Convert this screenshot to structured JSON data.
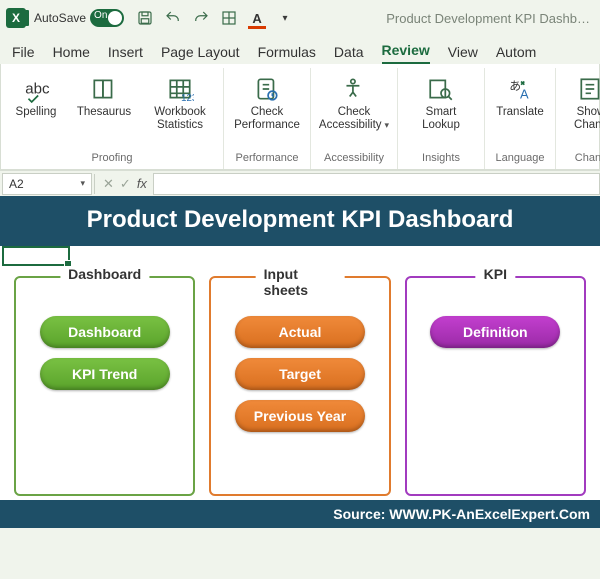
{
  "titlebar": {
    "autosave_label": "AutoSave",
    "autosave_state": "On",
    "doc_title": "Product Development KPI Dashb…"
  },
  "tabs": {
    "items": [
      "File",
      "Home",
      "Insert",
      "Page Layout",
      "Formulas",
      "Data",
      "Review",
      "View",
      "Autom"
    ],
    "active": "Review"
  },
  "ribbon": {
    "groups": [
      {
        "label": "Proofing",
        "items": [
          {
            "name": "spelling",
            "label": "Spelling"
          },
          {
            "name": "thesaurus",
            "label": "Thesaurus"
          },
          {
            "name": "workbook-stats",
            "label": "Workbook Statistics"
          }
        ]
      },
      {
        "label": "Performance",
        "items": [
          {
            "name": "check-performance",
            "label": "Check Performance"
          }
        ]
      },
      {
        "label": "Accessibility",
        "items": [
          {
            "name": "check-accessibility",
            "label": "Check Accessibility",
            "dropdown": true
          }
        ]
      },
      {
        "label": "Insights",
        "items": [
          {
            "name": "smart-lookup",
            "label": "Smart Lookup"
          }
        ]
      },
      {
        "label": "Language",
        "items": [
          {
            "name": "translate",
            "label": "Translate"
          }
        ]
      },
      {
        "label": "Chang",
        "items": [
          {
            "name": "show-changes",
            "label": "Show Chang"
          }
        ]
      }
    ]
  },
  "namebox": {
    "value": "A2"
  },
  "dashboard": {
    "title": "Product Development KPI Dashboard",
    "panels": [
      {
        "heading": "Dashboard",
        "color": "green",
        "buttons": [
          {
            "label": "Dashboard"
          },
          {
            "label": "KPI Trend"
          }
        ]
      },
      {
        "heading": "Input sheets",
        "color": "orange",
        "buttons": [
          {
            "label": "Actual"
          },
          {
            "label": "Target"
          },
          {
            "label": "Previous Year"
          }
        ]
      },
      {
        "heading": "KPI",
        "color": "purple",
        "buttons": [
          {
            "label": "Definition"
          }
        ]
      }
    ],
    "source": "Source: WWW.PK-AnExcelExpert.Com"
  }
}
